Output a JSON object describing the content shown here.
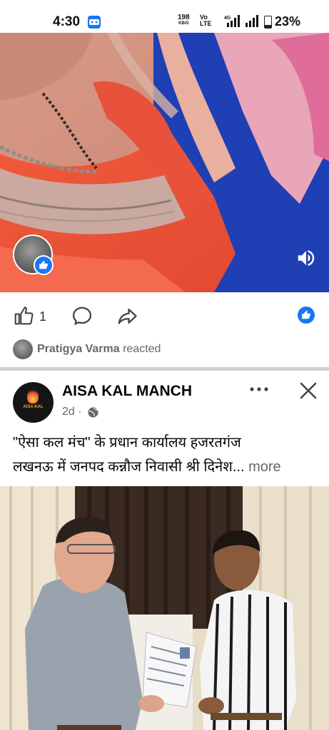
{
  "status_bar": {
    "time": "4:30",
    "net_speed": "198",
    "net_unit": "KB/S",
    "volte_top": "Vo",
    "volte_bottom": "LTE",
    "network_4g": "4G",
    "battery": "23%",
    "battery_level": 0.23
  },
  "video": {
    "sound_icon": "speaker-icon",
    "reactor_badge": "like-icon"
  },
  "actions": {
    "like_icon": "thumbs-up-icon",
    "like_count": "1",
    "comment_icon": "comment-icon",
    "share_icon": "share-icon",
    "reaction_icon": "like-reaction-icon"
  },
  "reacted": {
    "name": "Pratigya Varma",
    "text": "reacted"
  },
  "post": {
    "page_name": "AISA KAL MANCH",
    "logo_text": "AISA KAL",
    "time": "2d ·",
    "text_line_1": "\"ऐसा कल मंच\" के प्रधान कार्यालय हजरतगंज",
    "text_line_2": "लखनऊ में जनपद कन्नौज निवासी श्री दिनेश...",
    "more": "more"
  },
  "colors": {
    "brand_blue": "#1877f2",
    "secondary_text": "#65676b",
    "divider": "#ced0d4"
  }
}
